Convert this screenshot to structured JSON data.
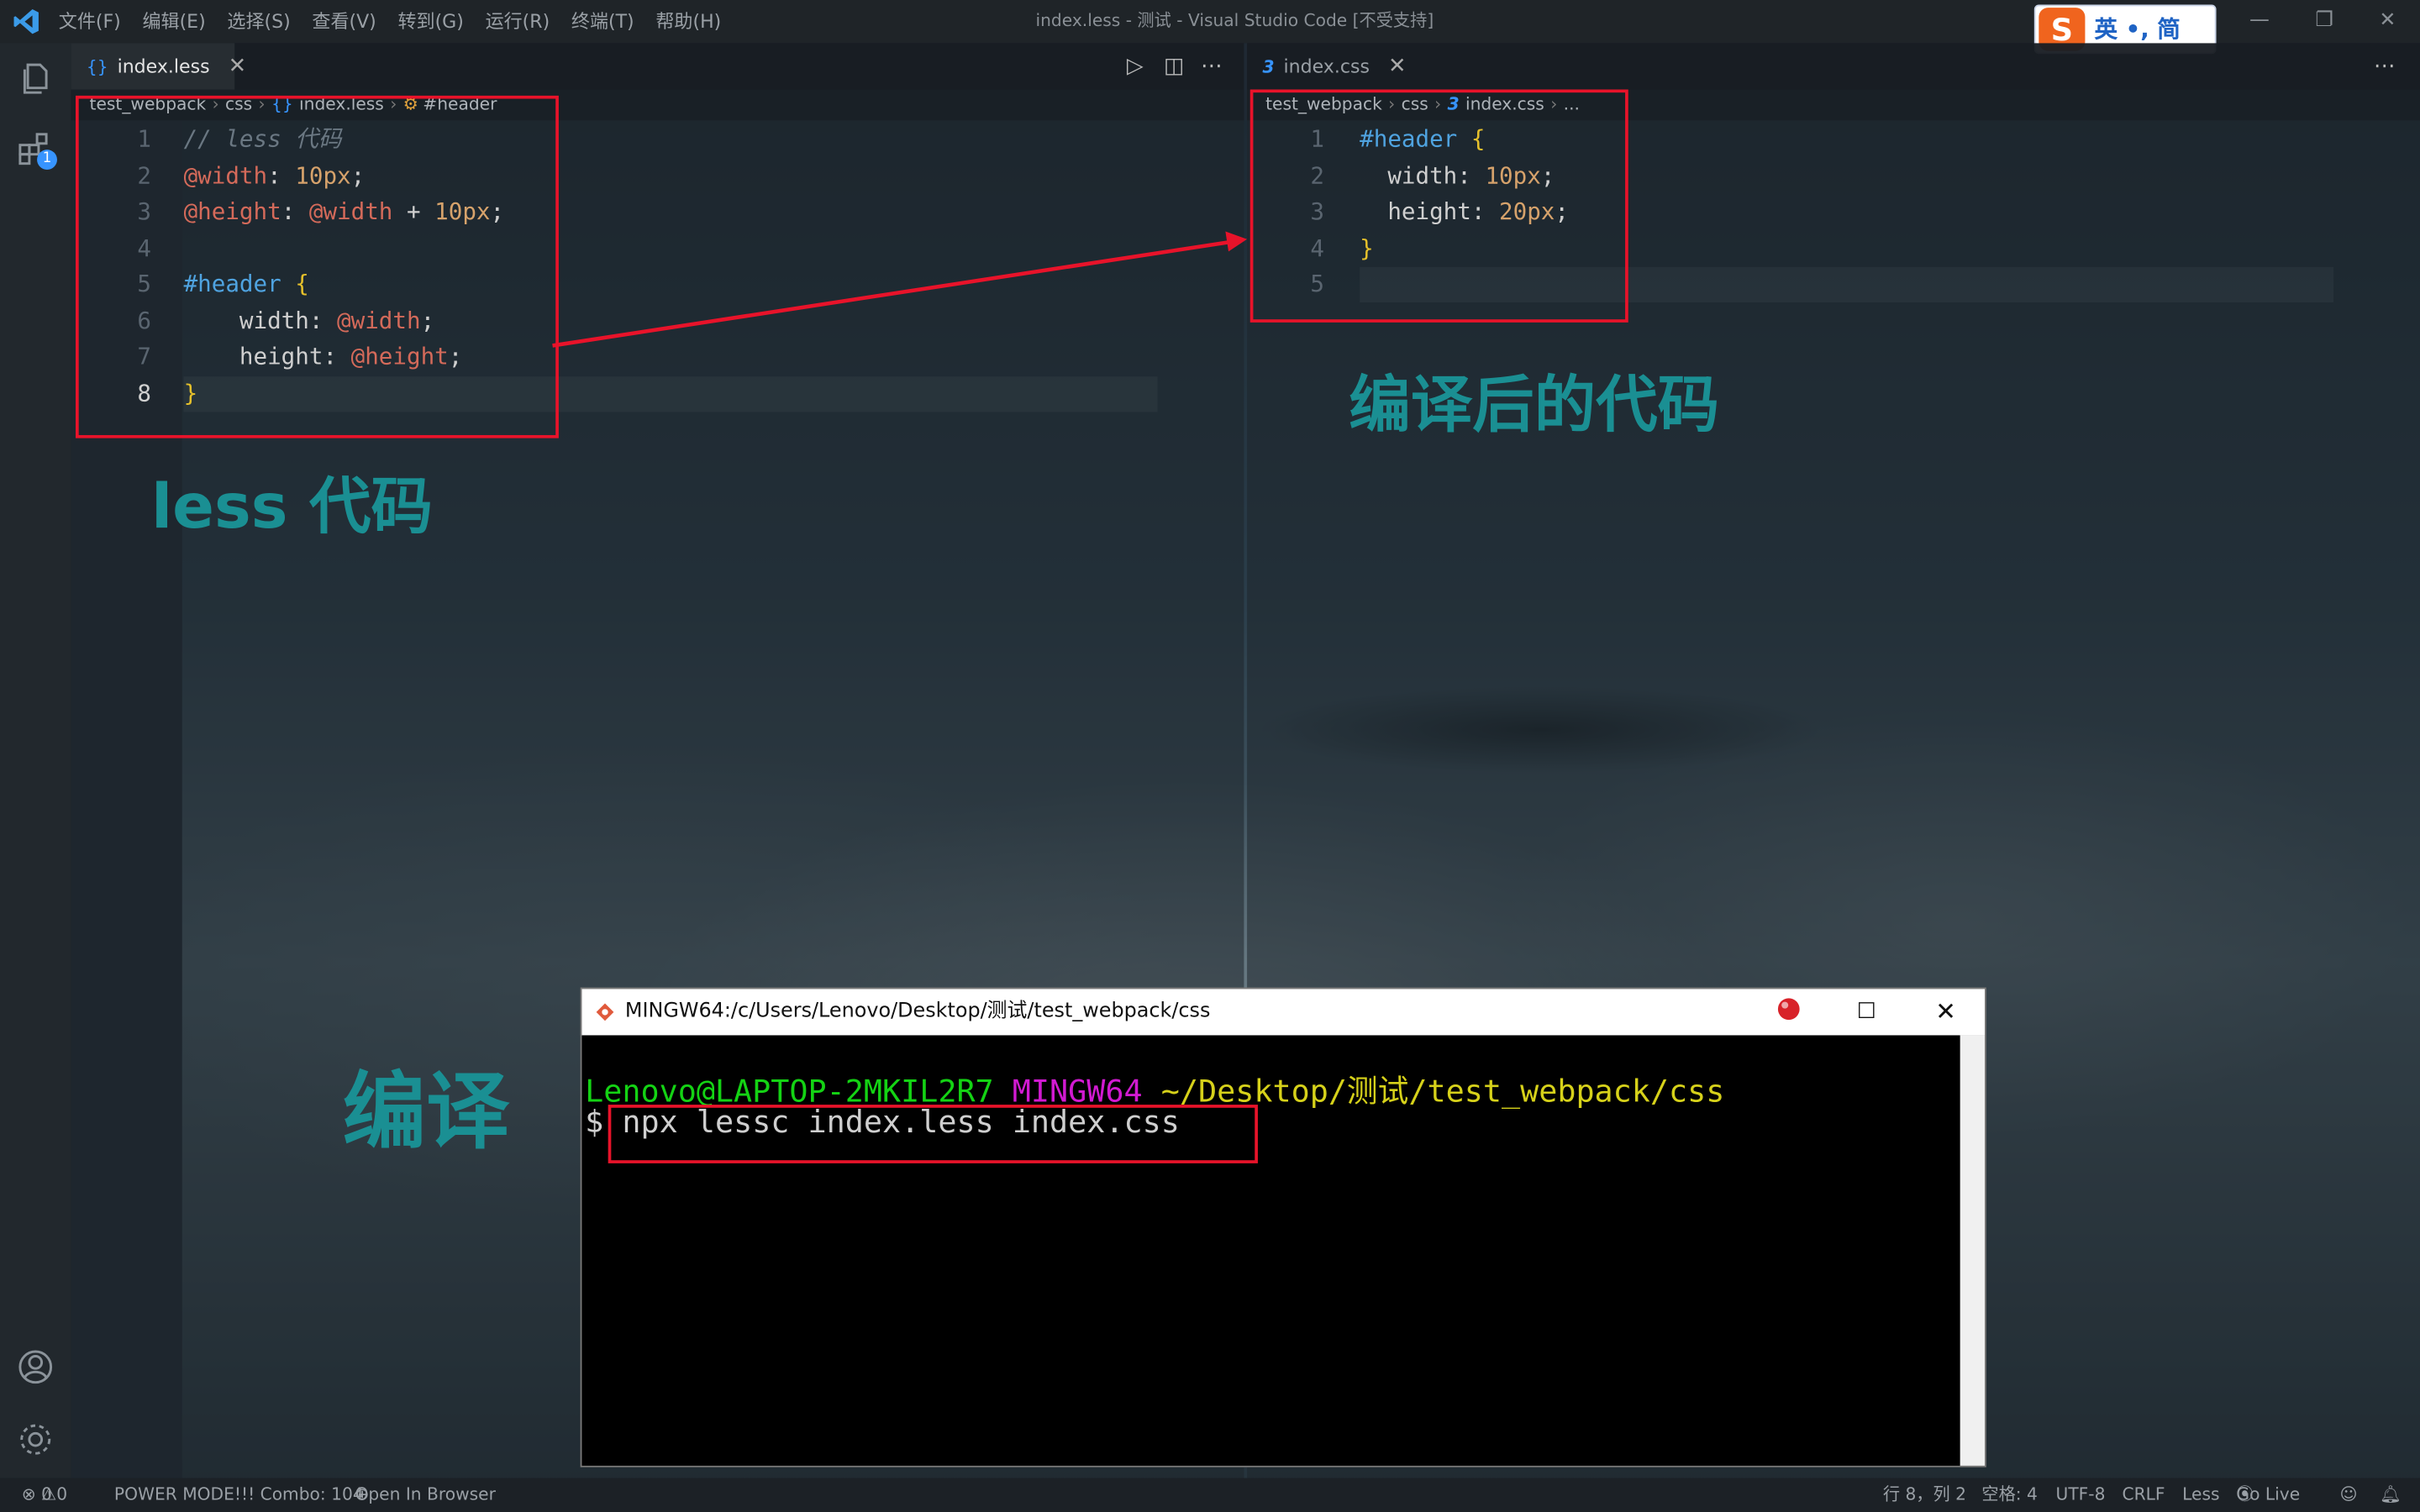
{
  "window": {
    "title": "index.less - 测试 - Visual Studio Code [不受支持]",
    "menu": [
      "文件(F)",
      "编辑(E)",
      "选择(S)",
      "查看(V)",
      "转到(G)",
      "运行(R)",
      "终端(T)",
      "帮助(H)"
    ]
  },
  "ime": {
    "logo": "S",
    "text": "英 •, 简"
  },
  "activity_bar": {
    "extensions_badge": "1"
  },
  "left_editor": {
    "tab_icon": "{}",
    "tab_label": "index.less",
    "breadcrumb": [
      "test_webpack",
      "css",
      "index.less",
      "#header"
    ],
    "breadcrumb_icons": {
      "file": "{}",
      "symbol": "⚙"
    },
    "line_numbers": [
      "1",
      "2",
      "3",
      "4",
      "5",
      "6",
      "7",
      "8"
    ],
    "active_line": "8",
    "lines": [
      [
        {
          "t": "// less 代码",
          "c": "cmt"
        }
      ],
      [
        {
          "t": "@width",
          "c": "var"
        },
        {
          "t": ": ",
          "c": "prop"
        },
        {
          "t": "10px",
          "c": "num"
        },
        {
          "t": ";",
          "c": "prop"
        }
      ],
      [
        {
          "t": "@height",
          "c": "var"
        },
        {
          "t": ": ",
          "c": "prop"
        },
        {
          "t": "@width",
          "c": "var"
        },
        {
          "t": " + ",
          "c": "prop"
        },
        {
          "t": "10px",
          "c": "num"
        },
        {
          "t": ";",
          "c": "prop"
        }
      ],
      [],
      [
        {
          "t": "#header",
          "c": "sel"
        },
        {
          "t": " ",
          "c": "prop"
        },
        {
          "t": "{",
          "c": "br"
        }
      ],
      [
        {
          "t": "    width: ",
          "c": "prop"
        },
        {
          "t": "@width",
          "c": "var"
        },
        {
          "t": ";",
          "c": "prop"
        }
      ],
      [
        {
          "t": "    height: ",
          "c": "prop"
        },
        {
          "t": "@height",
          "c": "var"
        },
        {
          "t": ";",
          "c": "prop"
        }
      ],
      [
        {
          "t": "}",
          "c": "br"
        }
      ]
    ]
  },
  "right_editor": {
    "tab_icon": "3",
    "tab_label": "index.css",
    "breadcrumb": [
      "test_webpack",
      "css",
      "index.css",
      "..."
    ],
    "breadcrumb_icons": {
      "file": "3"
    },
    "line_numbers": [
      "1",
      "2",
      "3",
      "4",
      "5"
    ],
    "lines": [
      [
        {
          "t": "#header",
          "c": "sel"
        },
        {
          "t": " ",
          "c": "prop"
        },
        {
          "t": "{",
          "c": "br"
        }
      ],
      [
        {
          "t": "  width: ",
          "c": "prop"
        },
        {
          "t": "10px",
          "c": "num"
        },
        {
          "t": ";",
          "c": "prop"
        }
      ],
      [
        {
          "t": "  height: ",
          "c": "prop"
        },
        {
          "t": "20px",
          "c": "num"
        },
        {
          "t": ";",
          "c": "prop"
        }
      ],
      [
        {
          "t": "}",
          "c": "br"
        }
      ],
      []
    ]
  },
  "annotations": {
    "less_code": "less 代码",
    "compiled_code": "编译后的代码",
    "compile": "编译"
  },
  "terminal": {
    "title": "MINGW64:/c/Users/Lenovo/Desktop/测试/test_webpack/css",
    "user": "Lenovo@LAPTOP-2MKIL2R7",
    "host": "MINGW64",
    "path": "~/Desktop/测试/test_webpack/css",
    "prompt": "$",
    "command": "npx lessc index.less index.css"
  },
  "status_bar": {
    "errors": "0",
    "warnings": "0",
    "power_mode": "POWER MODE!!! Combo: 104",
    "open_in_browser": "Open In Browser",
    "position": "行 8，列 2",
    "spaces": "空格: 4",
    "encoding": "UTF-8",
    "eol": "CRLF",
    "language": "Less",
    "go_live": "Go Live"
  },
  "colors": {
    "annotation": "#1a8f93",
    "highlight_box": "#e8132a",
    "terminal_user": "#14d314",
    "terminal_host": "#d11ad1",
    "terminal_path": "#d6d11a"
  }
}
